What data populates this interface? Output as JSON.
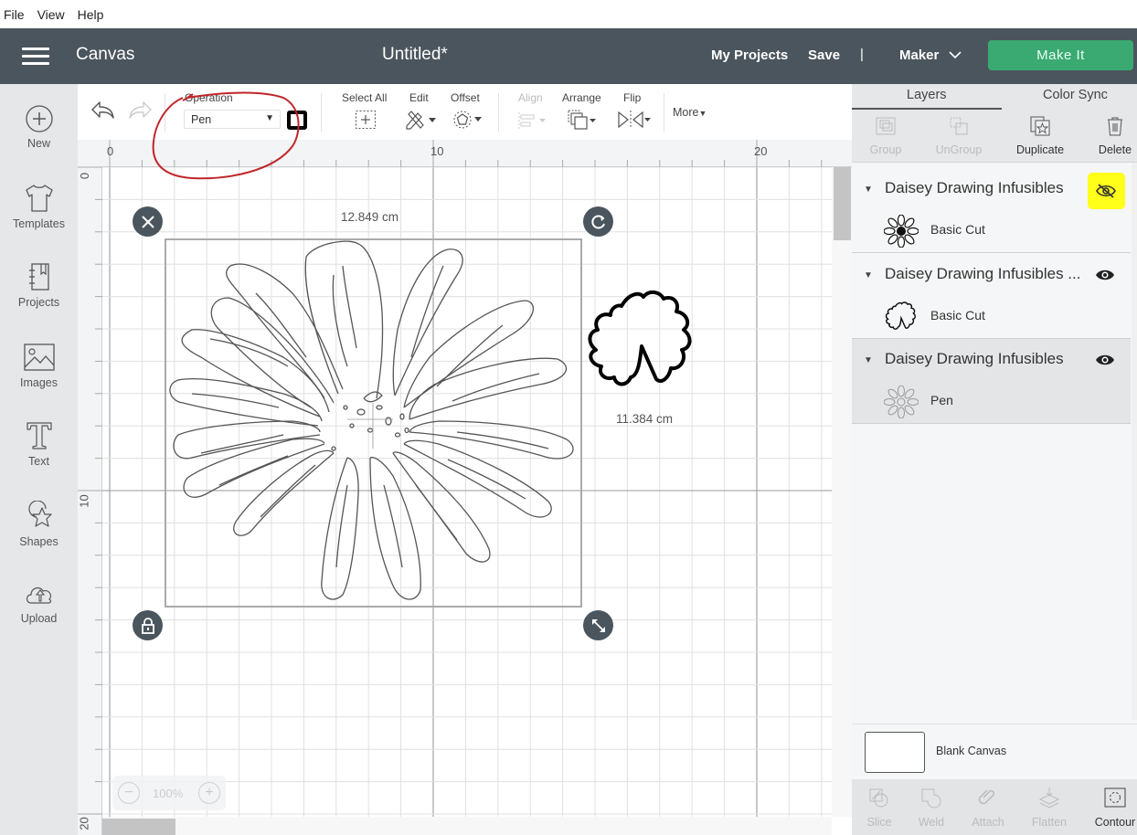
{
  "menu": [
    "File",
    "View",
    "Help"
  ],
  "header": {
    "section": "Canvas",
    "title": "Untitled*",
    "my_projects": "My Projects",
    "save": "Save",
    "separator": "|",
    "machine": "Maker",
    "make_it": "Make It",
    "make_it_color": "#3aaa72",
    "bg_color": "#4b555d"
  },
  "sidebar": [
    {
      "label": "New",
      "icon": "plus-circle-icon"
    },
    {
      "label": "Templates",
      "icon": "tshirt-icon"
    },
    {
      "label": "Projects",
      "icon": "notebook-icon"
    },
    {
      "label": "Images",
      "icon": "image-icon"
    },
    {
      "label": "Text",
      "icon": "text-t-icon"
    },
    {
      "label": "Shapes",
      "icon": "shapes-icon"
    },
    {
      "label": "Upload",
      "icon": "cloud-upload-icon"
    }
  ],
  "toolbar": {
    "operation_label": "Operation",
    "operation_value": "Pen",
    "select_all": "Select All",
    "edit": "Edit",
    "offset": "Offset",
    "align": "Align",
    "arrange": "Arrange",
    "flip": "Flip",
    "more": "More"
  },
  "rulers": {
    "horizontal": [
      "0",
      "10",
      "20"
    ],
    "vertical": [
      "0",
      "10",
      "20"
    ]
  },
  "canvas": {
    "width_label": "12.849 cm",
    "height_label": "11.384 cm",
    "zoom": "100%",
    "annotation_color": "#c0262b"
  },
  "layers_panel": {
    "tabs": [
      "Layers",
      "Color Sync"
    ],
    "actions": [
      {
        "label": "Group",
        "enabled": false
      },
      {
        "label": "UnGroup",
        "enabled": false
      },
      {
        "label": "Duplicate",
        "enabled": true
      },
      {
        "label": "Delete",
        "enabled": true
      }
    ],
    "groups": [
      {
        "name": "Daisey Drawing Infusibles",
        "visible": false,
        "highlighted": true,
        "operation": "Basic Cut",
        "selected": false
      },
      {
        "name": "Daisey Drawing Infusibles ...",
        "visible": true,
        "highlighted": false,
        "operation": "Basic Cut",
        "selected": false
      },
      {
        "name": "Daisey Drawing Infusibles",
        "visible": true,
        "highlighted": false,
        "operation": "Pen",
        "selected": true
      }
    ],
    "blank_canvas": "Blank Canvas",
    "bottom_actions": [
      {
        "label": "Slice",
        "enabled": false
      },
      {
        "label": "Weld",
        "enabled": false
      },
      {
        "label": "Attach",
        "enabled": false
      },
      {
        "label": "Flatten",
        "enabled": false
      },
      {
        "label": "Contour",
        "enabled": true
      }
    ]
  }
}
